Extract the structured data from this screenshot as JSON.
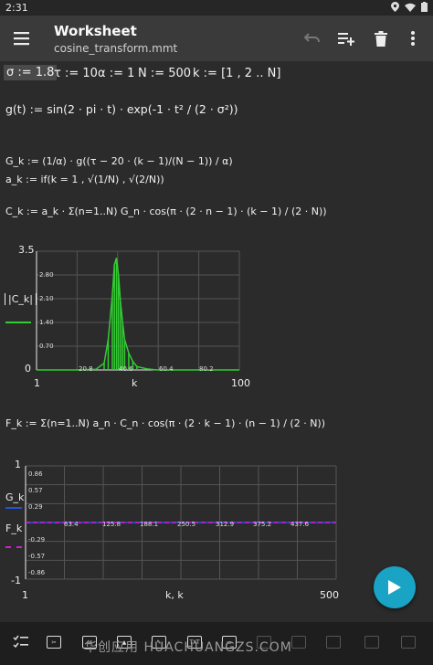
{
  "status": {
    "time": "2:31"
  },
  "appbar": {
    "title": "Worksheet",
    "subtitle": "cosine_transform.mmt"
  },
  "worksheet": {
    "params": {
      "sigma": "σ := 1.8",
      "tau": "τ := 10",
      "alpha": "α := 1",
      "N": "N := 500",
      "k": "k := [1 , 2 .. N]"
    },
    "g_def": "g(t) := sin(2 · pi · t) · exp(-1 · t² / (2 · σ²))",
    "G_def": "G_k := (1/α) · g((τ − 20 · (k − 1)/(N − 1)) / α)",
    "a_def": "a_k := if(k = 1 , √(1/N) , √(2/N))",
    "C_def": "C_k := a_k · Σ(n=1..N) G_n · cos(π · (2 · n − 1) · (k − 1) / (2 · N))",
    "F_def": "F_k := Σ(n=1..N) a_n · C_n · cos(π · (2 · k − 1) · (n − 1) / (2 · N))"
  },
  "plot1": {
    "ylabel": "|C_k|",
    "xlabel": "k",
    "xmin": "1",
    "xmax": "100",
    "ymax": "3.5",
    "ymin": "0",
    "yticks": [
      "2.80",
      "2.10",
      "1.40",
      "0.70"
    ],
    "xticks": [
      "20.8",
      "40.6",
      "60.4",
      "80.2"
    ]
  },
  "plot2": {
    "ylabel1": "G_k",
    "ylabel2": "F_k",
    "xlabel": "k, k",
    "xmin": "1",
    "xmax": "500",
    "ymax": "1",
    "ymin": "-1",
    "yticks": [
      "0.86",
      "0.57",
      "0.29",
      "-0.29",
      "-0.57",
      "-0.86"
    ],
    "xticks": [
      "63.4",
      "125.8",
      "188.1",
      "250.5",
      "312.9",
      "375.2",
      "437.6"
    ]
  },
  "chart_data": [
    {
      "type": "line",
      "title": "",
      "xlabel": "k",
      "ylabel": "|C_k|",
      "xlim": [
        1,
        100
      ],
      "ylim": [
        0,
        3.5
      ],
      "series": [
        {
          "name": "|C_k|",
          "color": "#33cc33",
          "x": [
            1,
            20,
            30,
            34,
            36,
            38,
            39,
            40,
            41,
            42,
            43,
            44,
            46,
            48,
            50,
            55,
            60,
            100
          ],
          "y": [
            0,
            0,
            0.02,
            0.2,
            0.9,
            2.2,
            3.1,
            3.3,
            2.8,
            2.0,
            1.4,
            0.9,
            0.5,
            0.25,
            0.1,
            0.03,
            0,
            0
          ]
        }
      ],
      "grid": true
    },
    {
      "type": "line",
      "title": "",
      "xlabel": "k, k",
      "xlim": [
        1,
        500
      ],
      "ylim": [
        -1,
        1
      ],
      "series": [
        {
          "name": "G_k",
          "color": "#2255dd",
          "x": [
            1,
            500
          ],
          "y": [
            0,
            0
          ]
        },
        {
          "name": "F_k",
          "color": "#d01fd0",
          "x": [
            1,
            500
          ],
          "y": [
            0,
            0
          ]
        }
      ],
      "grid": true
    }
  ],
  "colors": {
    "accent": "#19a3c4",
    "plot1_line": "#33cc33",
    "plot2_G": "#2255dd",
    "plot2_F": "#d01fd0"
  },
  "bottombar": {
    "watermark": "华创应用 HUACHUANGZS.COM",
    "txt_label": "TXT"
  }
}
